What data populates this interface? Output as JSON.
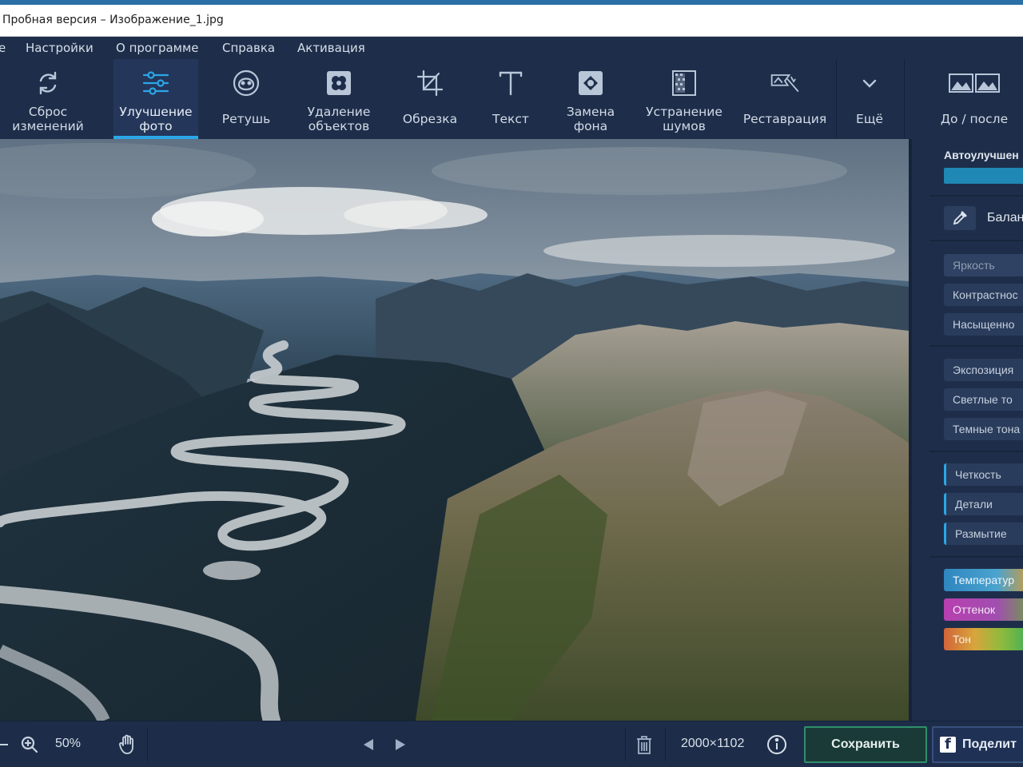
{
  "window": {
    "title": "Пробная версия – Изображение_1.jpg"
  },
  "menu": [
    {
      "label": "е"
    },
    {
      "label": "Настройки"
    },
    {
      "label": "О программе"
    },
    {
      "label": "Справка"
    },
    {
      "label": "Активация"
    }
  ],
  "toolbar": {
    "tools": [
      {
        "label": "Сброс\nизменений",
        "icon": "reset-icon"
      },
      {
        "label": "Улучшение\nфото",
        "icon": "sliders-icon",
        "active": true
      },
      {
        "label": "Ретушь",
        "icon": "face-icon"
      },
      {
        "label": "Удаление\nобъектов",
        "icon": "eraser-icon"
      },
      {
        "label": "Обрезка",
        "icon": "crop-icon"
      },
      {
        "label": "Текст",
        "icon": "text-icon"
      },
      {
        "label": "Замена\nфона",
        "icon": "background-icon"
      },
      {
        "label": "Устранение\nшумов",
        "icon": "noise-icon"
      },
      {
        "label": "Реставрация",
        "icon": "restore-icon"
      },
      {
        "label": "Ещё",
        "icon": "chevron-down-icon"
      },
      {
        "label": "До / после",
        "icon": "before-after-icon"
      }
    ]
  },
  "panel": {
    "auto_title": "Автоулучшен",
    "balance_label": "Балан",
    "sliders_group1": [
      "Яркость",
      "Контрастнос",
      "Насыщенно"
    ],
    "sliders_group2": [
      "Экспозиция",
      "Светлые то",
      "Темные тона"
    ],
    "sliders_group3": [
      "Четкость",
      "Детали",
      "Размытие"
    ],
    "sliders_group4": [
      "Температур",
      "Оттенок",
      "Тон"
    ]
  },
  "bottom": {
    "zoom": "50%",
    "dimensions": "2000×1102",
    "save_label": "Сохранить",
    "share_label": "Поделит"
  },
  "colors": {
    "background": "#1e2e4a",
    "accent": "#2aa7e8",
    "save_border": "#2f8f6a"
  }
}
